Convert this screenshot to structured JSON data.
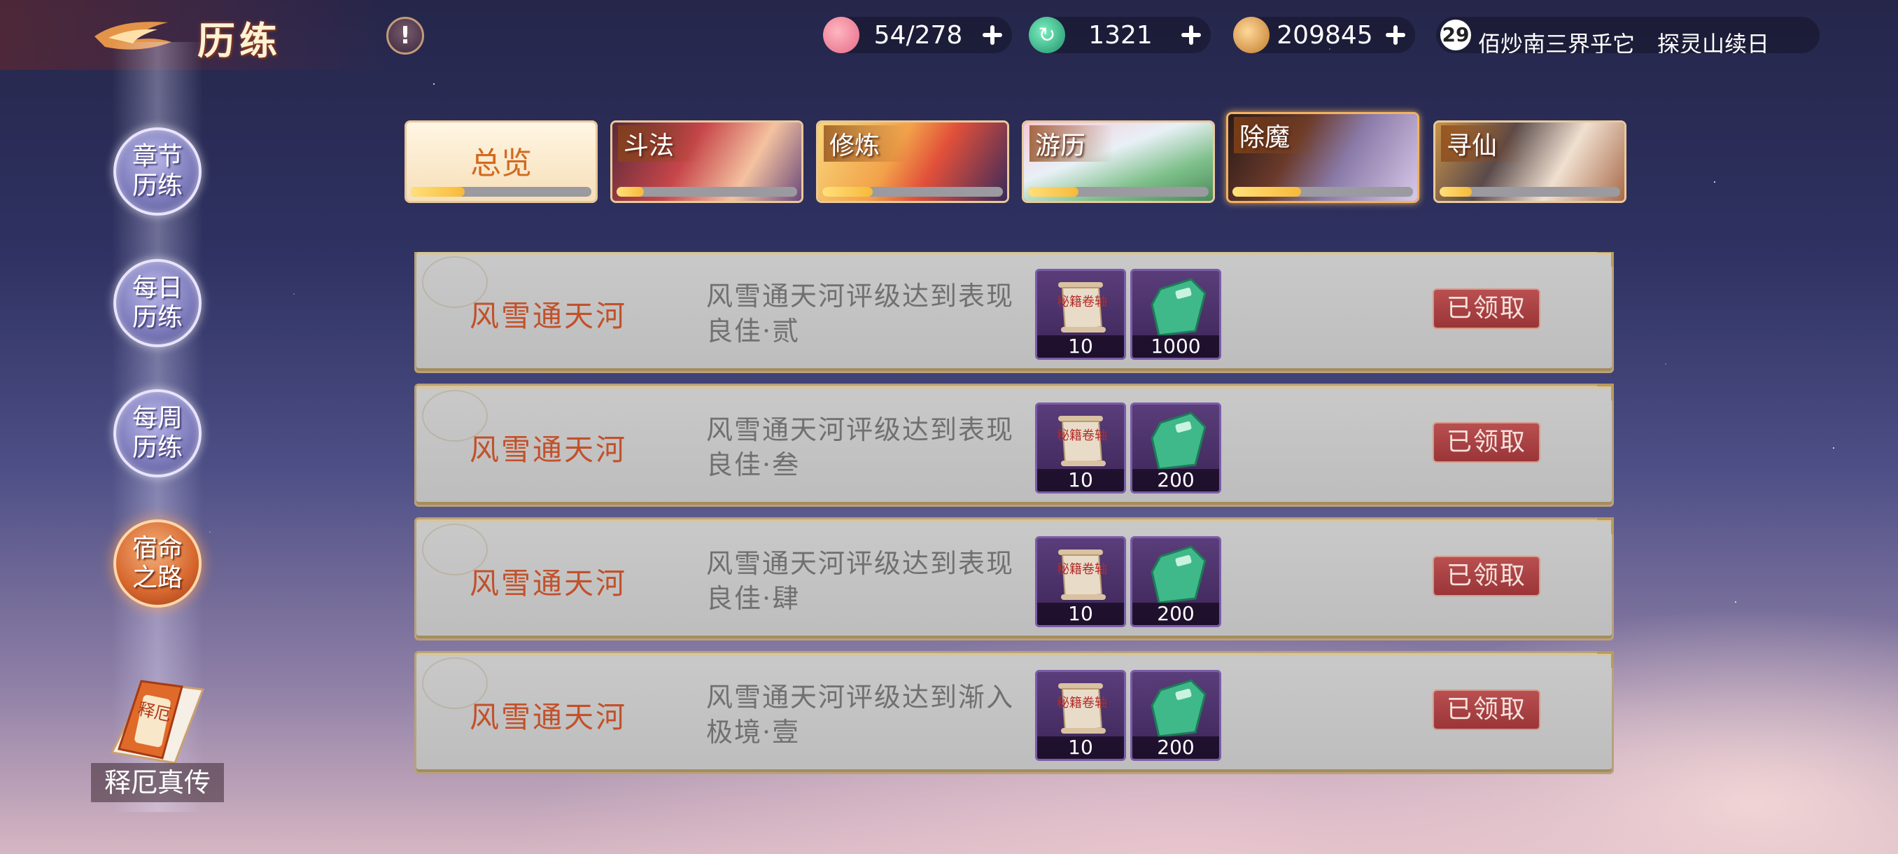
{
  "header": {
    "title": "历练",
    "info_label": "!",
    "resources": [
      {
        "name": "stamina",
        "icon": "peach-icon",
        "value": "54/278"
      },
      {
        "name": "jade",
        "icon": "jade-swirl-icon",
        "value": "1321"
      },
      {
        "name": "coins",
        "icon": "copper-coin-icon",
        "value": "209845"
      }
    ],
    "ticker": {
      "badge": "29",
      "message": "佰炒南三界乎它　探灵山续日"
    }
  },
  "sidebar": {
    "items": [
      {
        "label": "章节历练",
        "active": false
      },
      {
        "label": "每日历练",
        "active": false
      },
      {
        "label": "每周历练",
        "active": false
      },
      {
        "label": "宿命之路",
        "active": true
      }
    ],
    "book": {
      "icon_text": "释厄",
      "label": "释厄真传"
    }
  },
  "tabs": [
    {
      "label": "总览",
      "progress": 0.3,
      "active": false
    },
    {
      "label": "斗法",
      "progress": 0.15,
      "active": false
    },
    {
      "label": "修炼",
      "progress": 0.28,
      "active": false
    },
    {
      "label": "游历",
      "progress": 0.28,
      "active": false
    },
    {
      "label": "除魔",
      "progress": 0.38,
      "active": true
    },
    {
      "label": "寻仙",
      "progress": 0.18,
      "active": false
    }
  ],
  "task_list": {
    "partial_row": {
      "rewards": [
        {
          "count": "10"
        },
        {
          "count": "1000"
        }
      ]
    },
    "rows": [
      {
        "name": "风雪通天河",
        "desc": "风雪通天河评级达到表现良佳·贰",
        "rewards": [
          {
            "item": "秘籍卷轴",
            "count": "10"
          },
          {
            "item": "令牌",
            "count": "1000"
          }
        ],
        "status": "已领取"
      },
      {
        "name": "风雪通天河",
        "desc": "风雪通天河评级达到表现良佳·叁",
        "rewards": [
          {
            "item": "秘籍卷轴",
            "count": "10"
          },
          {
            "item": "令牌",
            "count": "200"
          }
        ],
        "status": "已领取"
      },
      {
        "name": "风雪通天河",
        "desc": "风雪通天河评级达到表现良佳·肆",
        "rewards": [
          {
            "item": "秘籍卷轴",
            "count": "10"
          },
          {
            "item": "令牌",
            "count": "200"
          }
        ],
        "status": "已领取"
      },
      {
        "name": "风雪通天河",
        "desc": "风雪通天河评级达到渐入极境·壹",
        "rewards": [
          {
            "item": "秘籍卷轴",
            "count": "10"
          },
          {
            "item": "令牌",
            "count": "200"
          }
        ],
        "status": "已领取"
      }
    ]
  },
  "colors": {
    "accent_orange": "#d26a20",
    "claimed_red": "#9a3538",
    "task_name": "#c2512a"
  }
}
